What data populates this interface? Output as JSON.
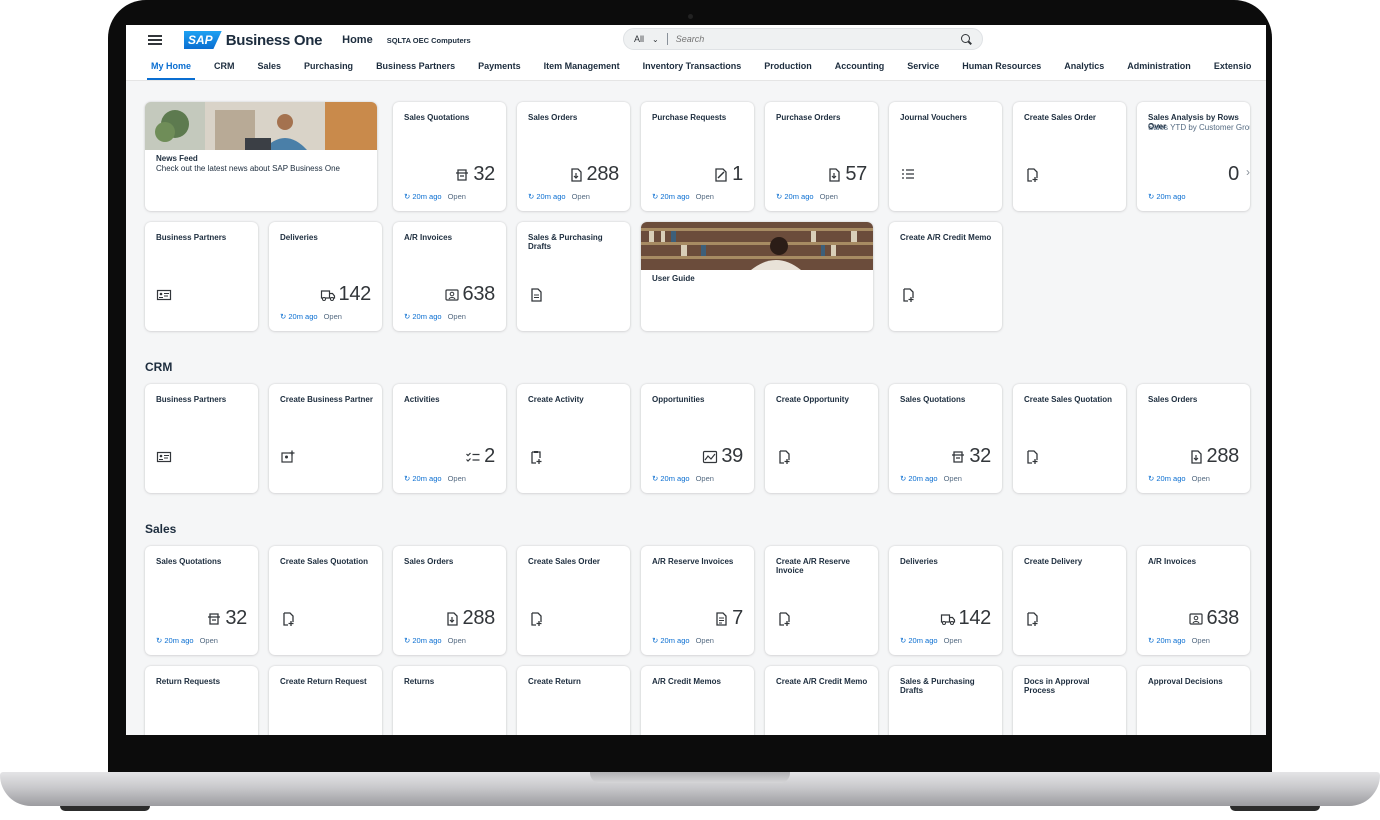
{
  "header": {
    "logo_text": "SAP",
    "product_name": "Business One",
    "home_label": "Home",
    "company_name": "SQLTA OEC Computers",
    "search_scope": "All",
    "search_placeholder": "Search"
  },
  "tabs": [
    "My Home",
    "CRM",
    "Sales",
    "Purchasing",
    "Business Partners",
    "Payments",
    "Item Management",
    "Inventory Transactions",
    "Production",
    "Accounting",
    "Service",
    "Human Resources",
    "Analytics",
    "Administration",
    "Extensio"
  ],
  "colors": {
    "accent": "#0a6ed1",
    "text": "#1d2d3e",
    "background": "#f5f6f7",
    "tile": "#ffffff"
  },
  "home": {
    "row1": [
      {
        "title": "News Feed",
        "desc": "Check out the latest news about SAP Business One",
        "type": "image",
        "image": "man-with-laptop"
      },
      {
        "title": "Sales Quotations",
        "kpi": "32",
        "icon": "quotation-icon",
        "refresh": "20m ago",
        "status": "Open"
      },
      {
        "title": "Sales Orders",
        "kpi": "288",
        "icon": "order-icon",
        "refresh": "20m ago",
        "status": "Open"
      },
      {
        "title": "Purchase Requests",
        "kpi": "1",
        "icon": "request-icon",
        "refresh": "20m ago",
        "status": "Open"
      },
      {
        "title": "Purchase Orders",
        "kpi": "57",
        "icon": "order-icon",
        "refresh": "20m ago",
        "status": "Open"
      },
      {
        "title": "Journal Vouchers",
        "icon": "list-icon"
      },
      {
        "title": "Create Sales Order",
        "icon": "create-document-icon"
      },
      {
        "title": "Sales Analysis by Rows Over",
        "subtitle": "Sales YTD by Customer Group",
        "kpi": "0",
        "refresh": "20m ago"
      }
    ],
    "row2": [
      {
        "title": "Business Partners",
        "icon": "business-card-icon"
      },
      {
        "title": "Deliveries",
        "kpi": "142",
        "icon": "truck-icon",
        "refresh": "20m ago",
        "status": "Open"
      },
      {
        "title": "A/R Invoices",
        "kpi": "638",
        "icon": "customer-invoice-icon",
        "refresh": "20m ago",
        "status": "Open"
      },
      {
        "title": "Sales & Purchasing Drafts",
        "icon": "draft-icon"
      },
      {
        "title": "User Guide",
        "type": "image",
        "image": "woman-in-library"
      },
      {
        "title": "Create A/R Credit Memo",
        "icon": "create-document-icon"
      }
    ]
  },
  "crm": {
    "title": "CRM",
    "tiles": [
      {
        "title": "Business Partners",
        "icon": "business-card-icon"
      },
      {
        "title": "Create Business Partner",
        "icon": "add-contact-icon"
      },
      {
        "title": "Activities",
        "kpi": "2",
        "icon": "checklist-icon",
        "refresh": "20m ago",
        "status": "Open"
      },
      {
        "title": "Create Activity",
        "icon": "create-activity-icon"
      },
      {
        "title": "Opportunities",
        "kpi": "39",
        "icon": "opportunity-icon",
        "refresh": "20m ago",
        "status": "Open"
      },
      {
        "title": "Create Opportunity",
        "icon": "create-document-icon"
      },
      {
        "title": "Sales Quotations",
        "kpi": "32",
        "icon": "quotation-icon",
        "refresh": "20m ago",
        "status": "Open"
      },
      {
        "title": "Create Sales Quotation",
        "icon": "create-document-icon"
      },
      {
        "title": "Sales Orders",
        "kpi": "288",
        "icon": "order-icon",
        "refresh": "20m ago",
        "status": "Open"
      }
    ]
  },
  "sales": {
    "title": "Sales",
    "row1": [
      {
        "title": "Sales Quotations",
        "kpi": "32",
        "icon": "quotation-icon",
        "refresh": "20m ago",
        "status": "Open"
      },
      {
        "title": "Create Sales Quotation",
        "icon": "create-document-icon"
      },
      {
        "title": "Sales Orders",
        "kpi": "288",
        "icon": "order-icon",
        "refresh": "20m ago",
        "status": "Open"
      },
      {
        "title": "Create Sales Order",
        "icon": "create-document-icon"
      },
      {
        "title": "A/R Reserve Invoices",
        "kpi": "7",
        "icon": "document-icon",
        "refresh": "20m ago",
        "status": "Open"
      },
      {
        "title": "Create A/R Reserve Invoice",
        "icon": "create-document-icon"
      },
      {
        "title": "Deliveries",
        "kpi": "142",
        "icon": "truck-icon",
        "refresh": "20m ago",
        "status": "Open"
      },
      {
        "title": "Create Delivery",
        "icon": "create-document-icon"
      },
      {
        "title": "A/R Invoices",
        "kpi": "638",
        "icon": "customer-invoice-icon",
        "refresh": "20m ago",
        "status": "Open"
      }
    ],
    "row2": [
      {
        "title": "Return Requests"
      },
      {
        "title": "Create Return Request"
      },
      {
        "title": "Returns"
      },
      {
        "title": "Create Return"
      },
      {
        "title": "A/R Credit Memos"
      },
      {
        "title": "Create A/R Credit Memo"
      },
      {
        "title": "Sales & Purchasing Drafts"
      },
      {
        "title": "Docs in Approval Process"
      },
      {
        "title": "Approval Decisions"
      }
    ]
  }
}
